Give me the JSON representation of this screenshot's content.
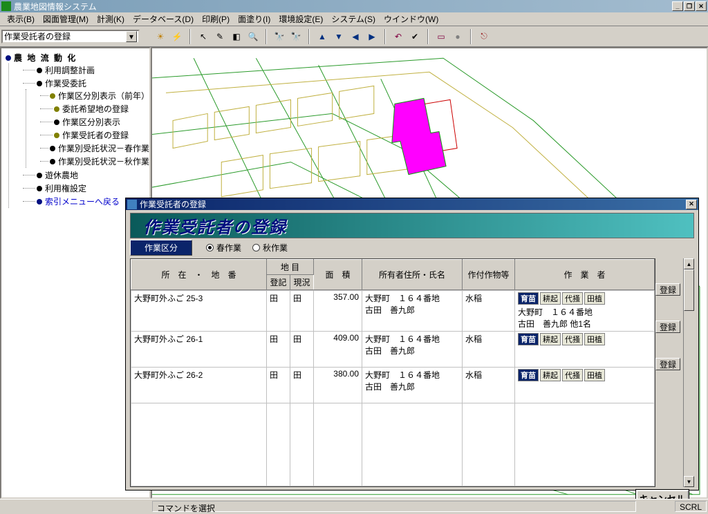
{
  "app": {
    "title": "農業地図情報システム"
  },
  "menu": {
    "items": [
      "表示(B)",
      "図面管理(M)",
      "計測(K)",
      "データベース(D)",
      "印刷(P)",
      "面塗り(I)",
      "環境設定(E)",
      "システム(S)",
      "ウインドウ(W)"
    ]
  },
  "combo": {
    "value": "作業受託者の登録"
  },
  "sidebar": {
    "root": "農 地 流 動 化",
    "items": [
      {
        "label": "利用調整計画",
        "bullet": "black"
      },
      {
        "label": "作業受委託",
        "bullet": "black",
        "children": [
          {
            "label": "作業区分別表示（前年）",
            "bullet": "olive"
          },
          {
            "label": "委託希望地の登録",
            "bullet": "olive"
          },
          {
            "label": "作業区分別表示",
            "bullet": "black"
          },
          {
            "label": "作業受託者の登録",
            "bullet": "olive"
          },
          {
            "label": "作業別受託状況－春作業",
            "bullet": "black"
          },
          {
            "label": "作業別受託状況－秋作業",
            "bullet": "black"
          }
        ]
      },
      {
        "label": "遊休農地",
        "bullet": "black"
      },
      {
        "label": "利用権設定",
        "bullet": "black"
      },
      {
        "label": "索引メニューへ戻る",
        "bullet": "blue",
        "sel": true
      }
    ]
  },
  "dialog": {
    "title": "作業受託者の登録",
    "header": "作業受託者の登録",
    "section": "作業区分",
    "radios": [
      {
        "label": "春作業",
        "checked": true
      },
      {
        "label": "秋作業",
        "checked": false
      }
    ],
    "columns": {
      "c1": "所　在　・　地　番",
      "c2": "地 目",
      "c2a": "登記",
      "c2b": "現況",
      "c3": "面　積",
      "c4": "所有者住所・氏名",
      "c5": "作付作物等",
      "c6": "作　業　者"
    },
    "rows": [
      {
        "loc": "大野町外ふご 25-3",
        "reg": "田",
        "cur": "田",
        "area": "357.00",
        "owner": "大野町　１６４番地\n古田　善九郎",
        "crop": "水稲",
        "tags": [
          "育苗",
          "耕起",
          "代掻",
          "田植"
        ],
        "extra": "大野町　１６４番地\n古田　善九郎 他1名"
      },
      {
        "loc": "大野町外ふご 26-1",
        "reg": "田",
        "cur": "田",
        "area": "409.00",
        "owner": "大野町　１６４番地\n古田　善九郎",
        "crop": "水稲",
        "tags": [
          "育苗",
          "耕起",
          "代掻",
          "田植"
        ],
        "extra": ""
      },
      {
        "loc": "大野町外ふご 26-2",
        "reg": "田",
        "cur": "田",
        "area": "380.00",
        "owner": "大野町　１６４番地\n古田　善九郎",
        "crop": "水稲",
        "tags": [
          "育苗",
          "耕起",
          "代掻",
          "田植"
        ],
        "extra": ""
      }
    ],
    "reg_btn": "登録",
    "cancel": "キャンセル"
  },
  "status": {
    "text": "コマンドを選択",
    "scrl": "SCRL"
  }
}
